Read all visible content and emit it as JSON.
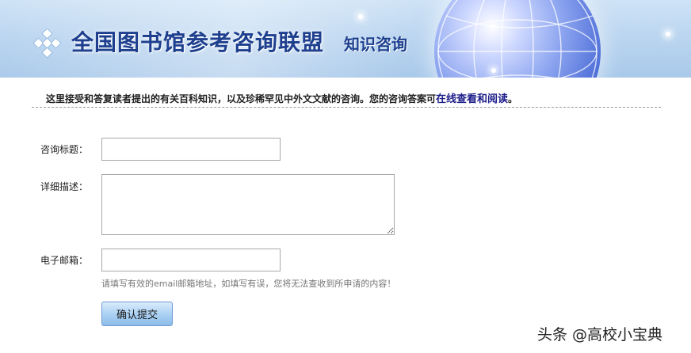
{
  "banner": {
    "title": "全国图书馆参考咨询联盟",
    "subtitle": "知识咨询",
    "logo_icon": "diamond-cluster-icon",
    "globe_icon": "globe-icon"
  },
  "intro": {
    "text": "这里接受和答复读者提出的有关百科知识，以及珍稀罕见中外文文献的咨询。您的咨询答案可",
    "link_text": "在线查看和阅读",
    "end": "。"
  },
  "form": {
    "title_label": "咨询标题：",
    "title_value": "",
    "description_label": "详细描述：",
    "description_value": "",
    "email_label": "电子邮箱：",
    "email_value": "",
    "email_hint": "请填写有效的email邮箱地址，如填写有误，您将无法查收到所申请的内容！",
    "submit_label": "确认提交"
  },
  "watermark": "头条 @高校小宝典",
  "colors": {
    "title": "#1d3f8e",
    "link": "#1d1d8a",
    "button_top": "#d8ebfb",
    "button_bottom": "#8dbde9"
  }
}
